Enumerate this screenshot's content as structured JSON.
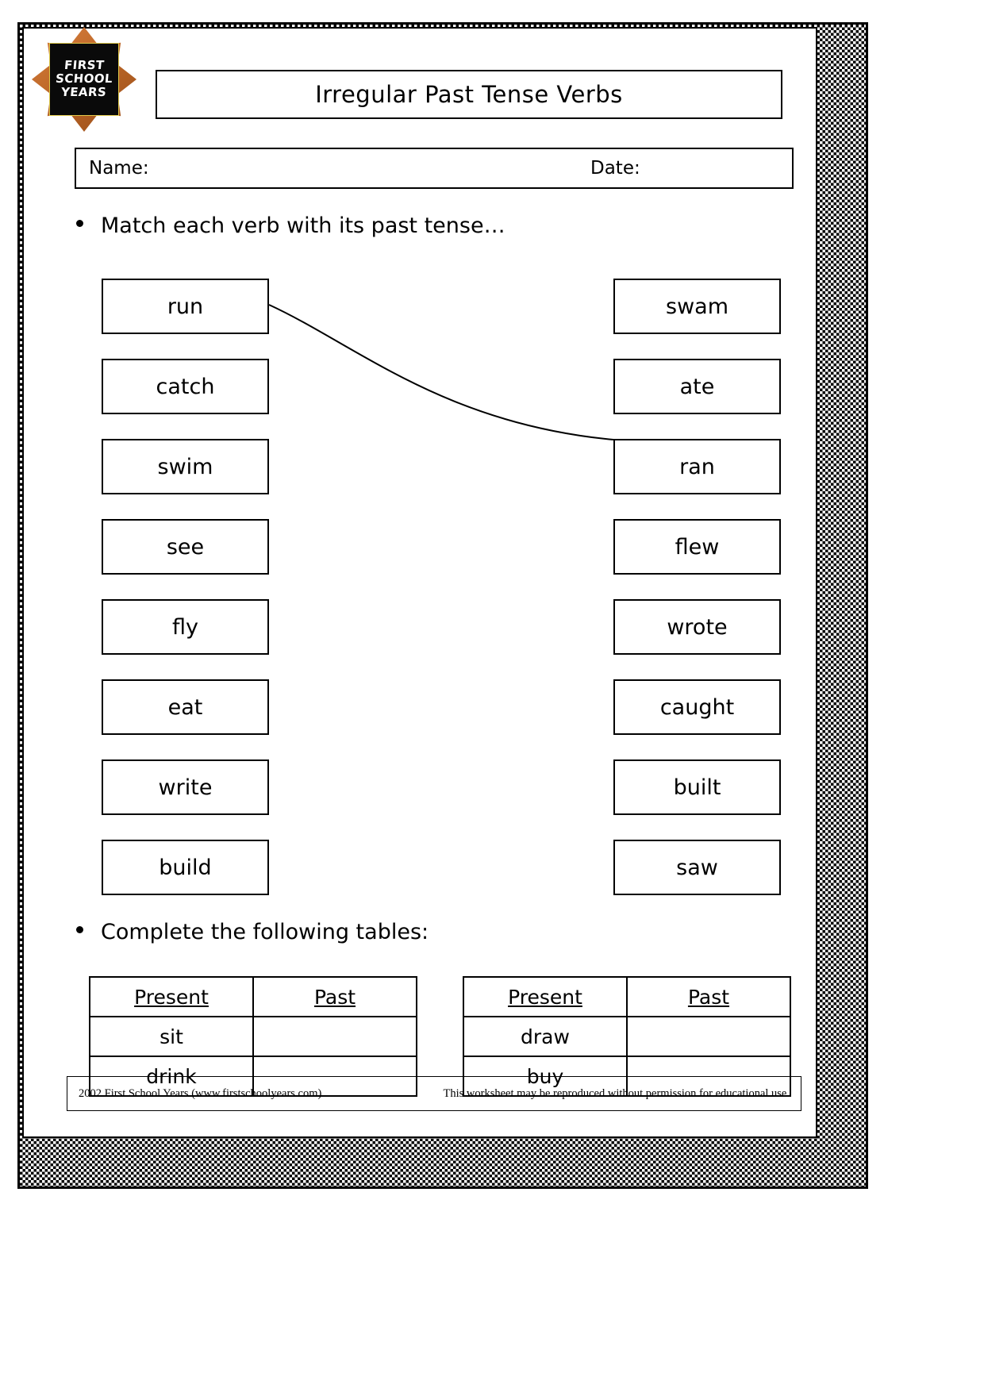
{
  "logo": {
    "line1": "FIRST",
    "line2": "SCHOOL",
    "line3": "YEARS",
    "badge_color": "#c06a2a",
    "plate_color": "#0a0a0a",
    "plate_border_color": "#e0c84a"
  },
  "header": {
    "title": "Irregular Past Tense Verbs",
    "name_label": "Name:",
    "date_label": "Date:"
  },
  "instructions": {
    "first": "Match each verb with its past tense…",
    "second": "Complete the following tables:"
  },
  "matching": {
    "present_verbs": [
      "run",
      "catch",
      "swim",
      "see",
      "fly",
      "eat",
      "write",
      "build"
    ],
    "past_verbs": [
      "swam",
      "ate",
      "ran",
      "flew",
      "wrote",
      "caught",
      "built",
      "saw"
    ],
    "drawn_connection": {
      "from": "run",
      "to": "ran"
    }
  },
  "tables": [
    {
      "id": "table-left",
      "headers": [
        "Present",
        "Past"
      ],
      "rows": [
        {
          "present": "sit",
          "past": ""
        },
        {
          "present": "drink",
          "past": ""
        }
      ]
    },
    {
      "id": "table-right",
      "headers": [
        "Present",
        "Past"
      ],
      "rows": [
        {
          "present": "draw",
          "past": ""
        },
        {
          "present": "buy",
          "past": ""
        }
      ]
    }
  ],
  "footer": {
    "left": "2002 First School Years  (www.firstschoolyears.com)",
    "right": "This worksheet may be reproduced without permission for educational use."
  }
}
